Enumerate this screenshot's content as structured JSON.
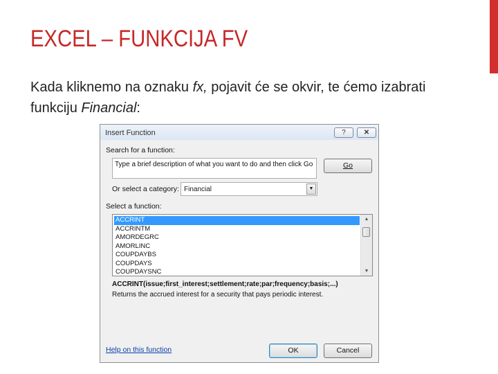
{
  "slide": {
    "title": "EXCEL – FUNKCIJA FV",
    "body": {
      "part1": "Kada kliknemo na oznaku ",
      "fx": "fx,",
      "part2": " pojavit će se okvir, te ćemo izabrati funkciju ",
      "financial": "Financial",
      "part3": ":"
    },
    "accent_color": "#c62828"
  },
  "dialog": {
    "title": "Insert Function",
    "help_button": "?",
    "close_button": "✕",
    "search_label": "Search for a function:",
    "search_value": "Type a brief description of what you want to do and then click Go",
    "go_label": "Go",
    "category_label": "Or select a category:",
    "category_value": "Financial",
    "category_arrow": "▼",
    "select_label": "Select a function:",
    "functions": [
      "ACCRINT",
      "ACCRINTM",
      "AMORDEGRC",
      "AMORLINC",
      "COUPDAYBS",
      "COUPDAYS",
      "COUPDAYSNC"
    ],
    "selected_function": "ACCRINT",
    "scroll_up": "▲",
    "scroll_down": "▼",
    "signature": "ACCRINT(issue;first_interest;settlement;rate;par;frequency;basis;...)",
    "description": "Returns the accrued interest for a security that pays periodic interest.",
    "help_link": "Help on this function",
    "ok_label": "OK",
    "cancel_label": "Cancel"
  }
}
